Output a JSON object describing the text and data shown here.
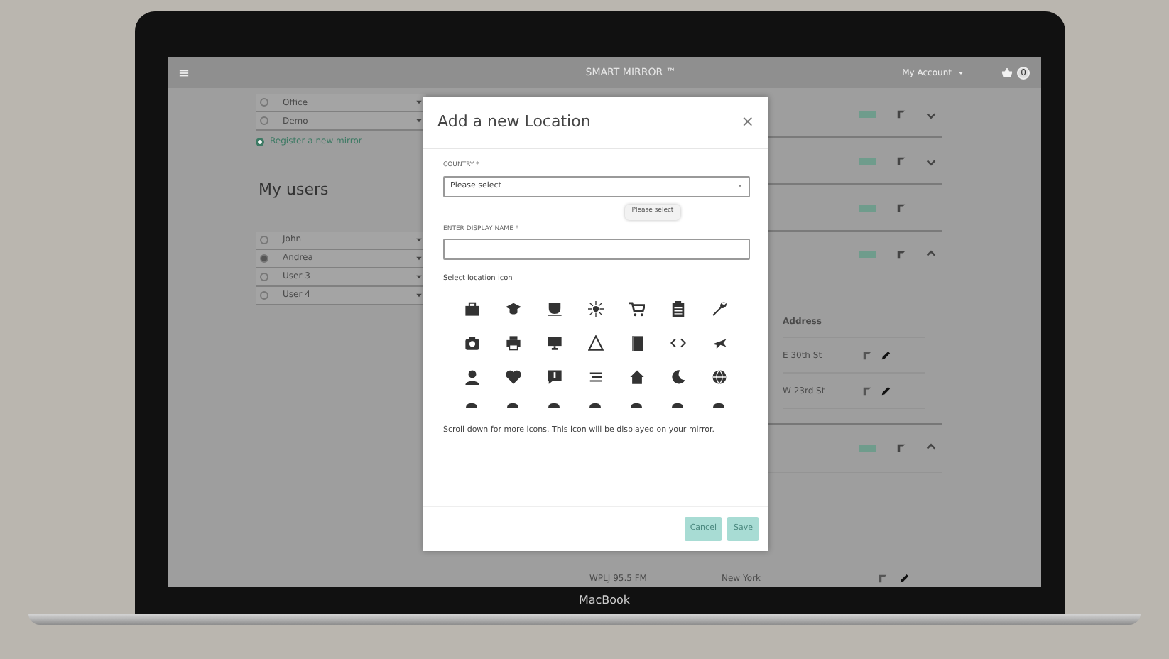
{
  "navbar": {
    "title": "SMART MIRROR ™",
    "account": "My Account",
    "cart_count": "0"
  },
  "mirrors": [
    {
      "name": "Office",
      "selected": false
    },
    {
      "name": "Demo",
      "selected": false
    }
  ],
  "register_link": "Register a new mirror",
  "users_heading": "My users",
  "users": [
    {
      "name": "John",
      "selected": false
    },
    {
      "name": "Andrea",
      "selected": true
    },
    {
      "name": "User 3",
      "selected": false
    },
    {
      "name": "User 4",
      "selected": false
    }
  ],
  "mirror_rows": [
    {
      "kind": "toggle",
      "expanded": false
    },
    {
      "kind": "toggle",
      "expanded": false
    },
    {
      "kind": "plain"
    },
    {
      "kind": "toggle",
      "expanded": true
    }
  ],
  "table": {
    "columns": [
      "Address"
    ],
    "rows": [
      [
        "E 30th St"
      ],
      [
        "W 23rd St"
      ]
    ]
  },
  "after_rows": [
    {
      "kind": "toggle",
      "expanded": true
    }
  ],
  "bottom_row": [
    "WPLJ 95.5 FM",
    "New York"
  ],
  "modal": {
    "title": "Add a new Location",
    "close": "×",
    "fields": [
      {
        "kind": "select",
        "label": "COUNTRY *",
        "value": "Please select"
      },
      {
        "kind": "text",
        "label": "ENTER DISPLAY NAME *"
      }
    ],
    "tooltip": "Please select",
    "icon_label": "Select location icon",
    "hint": "Scroll down for more icons. This icon will be displayed on your mirror.",
    "buttons": [
      "Cancel",
      "Save"
    ]
  },
  "laptop_label": "MacBook"
}
